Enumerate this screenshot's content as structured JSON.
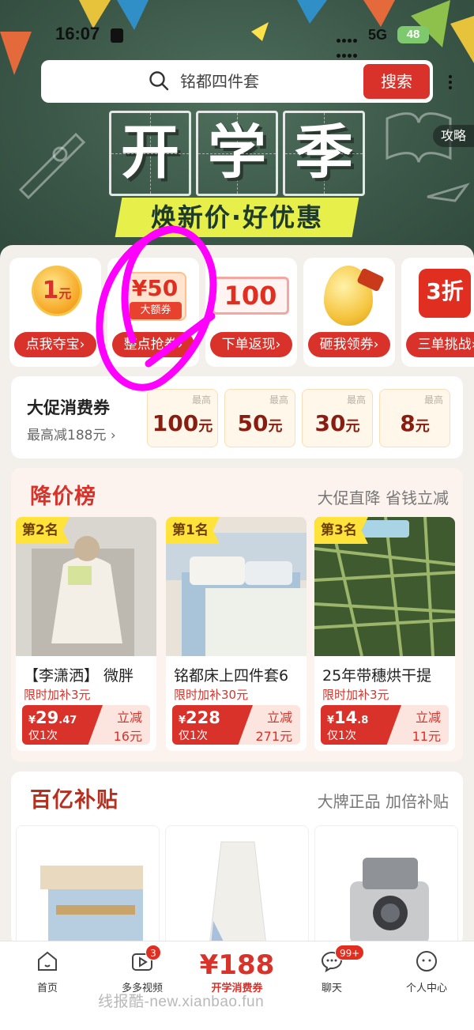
{
  "status_bar": {
    "time": "16:07",
    "network": "5G",
    "battery": "48"
  },
  "search": {
    "placeholder": "铭都四件套",
    "button_label": "搜索"
  },
  "banner": {
    "title_chars": [
      "开",
      "学",
      "季"
    ],
    "subtitle": "焕新价·好优惠",
    "side_tag": "攻略"
  },
  "promo_cards": [
    {
      "label": "点我夺宝",
      "art_text": "1",
      "art_unit": "元"
    },
    {
      "label": "整点抢券",
      "art_text": "¥50",
      "art_tag": "大额券"
    },
    {
      "label": "下单返现",
      "art_text": "100"
    },
    {
      "label": "砸我领券"
    },
    {
      "label": "三单挑战",
      "art_text": "3折"
    }
  ],
  "consume_coupon": {
    "title": "大促消费券",
    "subtitle": "最高减188元",
    "label": "最高",
    "values": [
      {
        "amount": "100",
        "unit": "元"
      },
      {
        "amount": "50",
        "unit": "元"
      },
      {
        "amount": "30",
        "unit": "元"
      },
      {
        "amount": "8",
        "unit": "元"
      }
    ]
  },
  "price_drop": {
    "title": "降价榜",
    "subtitle": "大促直降 省钱立减",
    "products": [
      {
        "rank": "第2名",
        "name": "【李潇洒】 微胖",
        "bonus": "限时加补3元",
        "price_int": "29",
        "price_dec": ".47",
        "once": "仅1次",
        "cut_label": "立减",
        "cut_value": "16元"
      },
      {
        "rank": "第1名",
        "name": "铭都床上四件套6",
        "bonus": "限时加补30元",
        "price_int": "228",
        "price_dec": "",
        "once": "仅1次",
        "cut_label": "立减",
        "cut_value": "271元"
      },
      {
        "rank": "第3名",
        "name": "25年带穗烘干提",
        "bonus": "限时加补3元",
        "price_int": "14",
        "price_dec": ".8",
        "once": "仅1次",
        "cut_label": "立减",
        "cut_value": "11元"
      }
    ]
  },
  "subsidy": {
    "title": "百亿补贴",
    "subtitle": "大牌正品 加倍补贴"
  },
  "tab_bar": {
    "items": [
      {
        "label": "首页",
        "icon": "home-icon"
      },
      {
        "label": "多多视频",
        "icon": "video-icon",
        "badge": "3"
      },
      {
        "label": "开学消费券",
        "amount": "¥188"
      },
      {
        "label": "聊天",
        "icon": "chat-icon",
        "badge": "99+"
      },
      {
        "label": "个人中心",
        "icon": "profile-icon"
      }
    ]
  },
  "watermark": "线报酷-new.xianbao.fun",
  "colors": {
    "accent": "#d8322a",
    "board_green": "#3c5849",
    "scribble": "#ff00ff"
  }
}
